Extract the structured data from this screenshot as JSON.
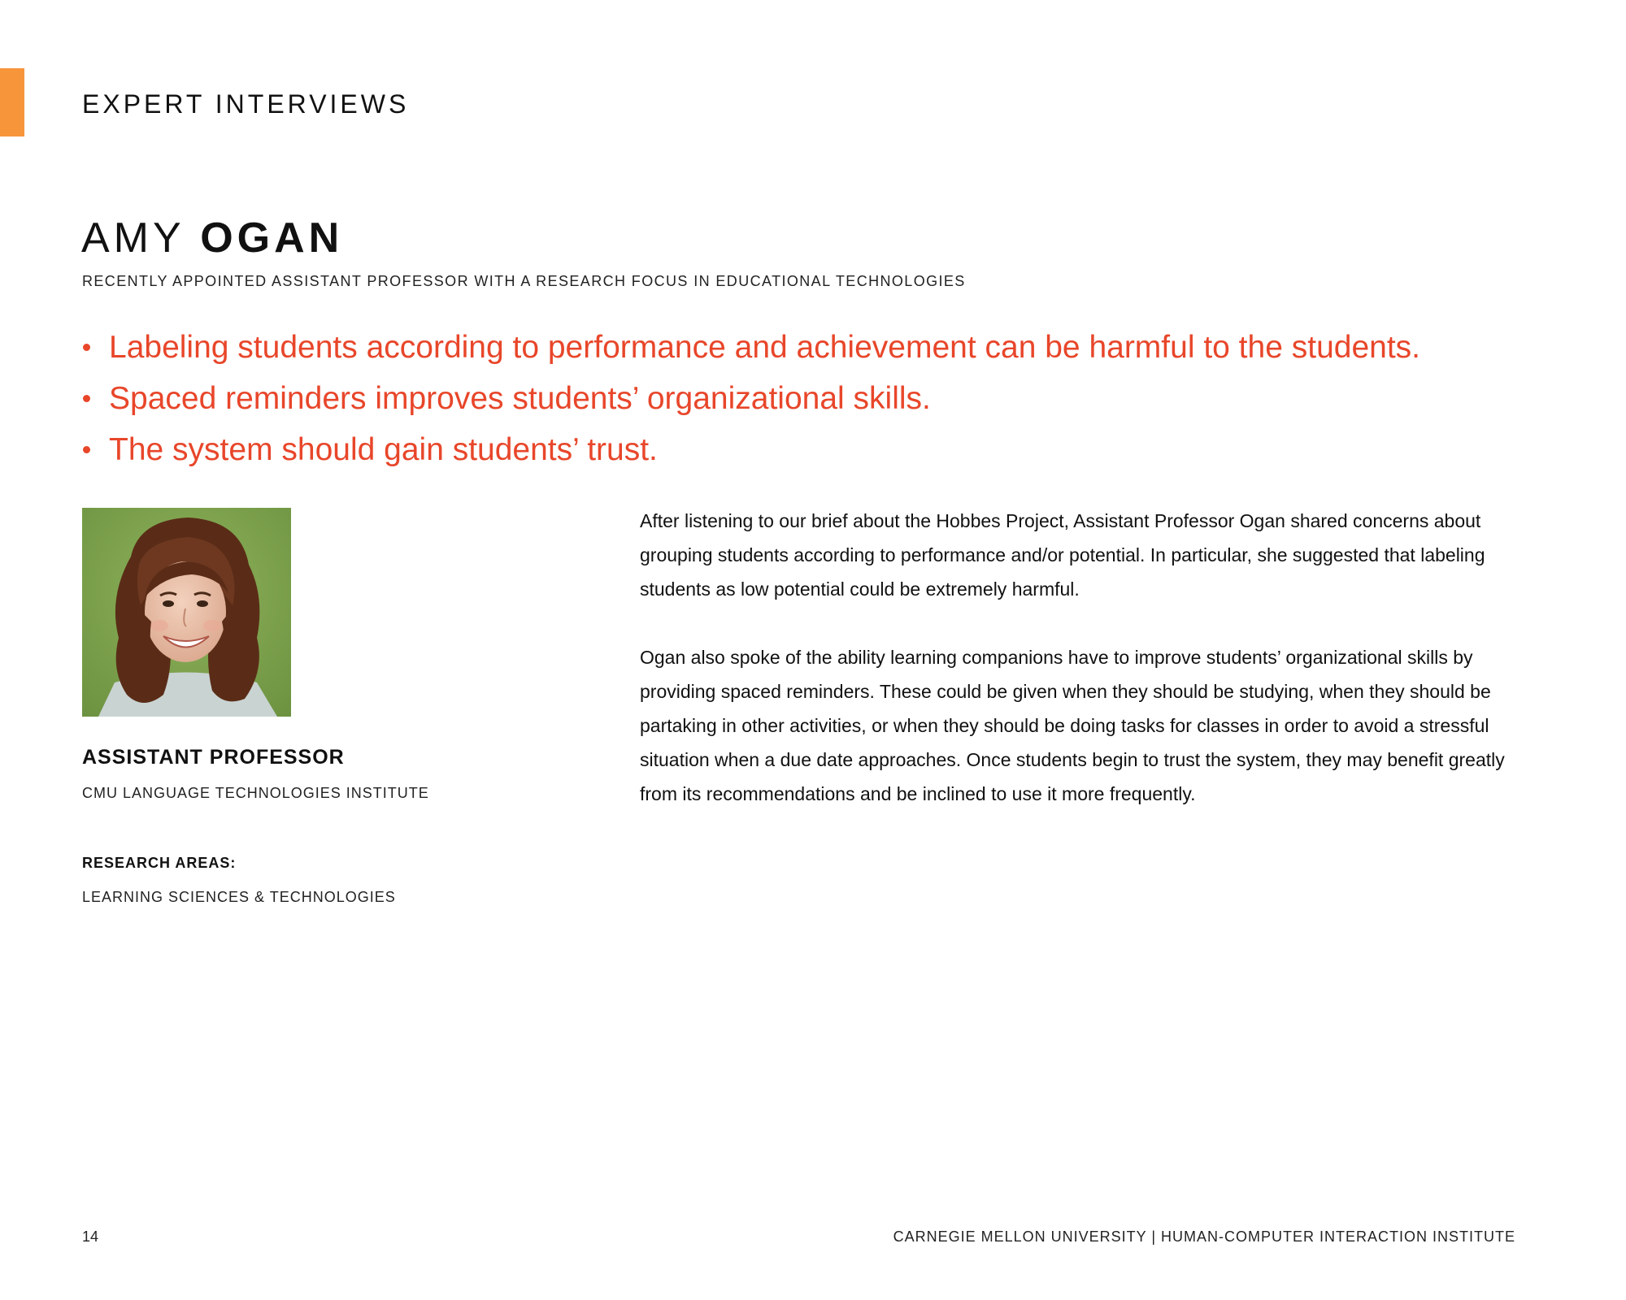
{
  "section": {
    "title": "EXPERT INTERVIEWS"
  },
  "expert": {
    "first_name": "AMY",
    "last_name": "OGAN",
    "subtitle": "RECENTLY APPOINTED ASSISTANT PROFESSOR WITH A RESEARCH FOCUS IN EDUCATIONAL TECHNOLOGIES",
    "role": "ASSISTANT PROFESSOR",
    "institute": "CMU LANGUAGE TECHNOLOGIES INSTITUTE",
    "research_heading": "RESEARCH AREAS:",
    "research_areas": "LEARNING SCIENCES & TECHNOLOGIES"
  },
  "takeaways": [
    "Labeling students according to performance and achievement can be harmful to the students.",
    "Spaced reminders improves students’ organizational skills.",
    "The system should gain students’ trust."
  ],
  "body": {
    "paragraphs": [
      "After listening to our brief about the Hobbes Project, Assistant Professor Ogan shared concerns about grouping students according to performance and/or potential. In particular, she suggested that labeling students as low potential could be extremely harmful.",
      "Ogan also spoke of the ability learning companions have to improve students’ organizational skills by providing spaced reminders. These could be given when they should be studying, when they should be partaking in other activities, or when they should be doing tasks for classes in order to avoid a stressful situation when a due date approaches. Once students begin to trust the system, they may benefit greatly from its recommendations and be inclined to use it more frequently."
    ]
  },
  "footer": {
    "page_number": "14",
    "organization": "CARNEGIE MELLON UNIVERSITY | HUMAN-COMPUTER INTERACTION INSTITUTE"
  },
  "colors": {
    "accent_tab": "#f7953b",
    "takeaway_text": "#e8462a",
    "photo_background": "#7ea34a"
  }
}
